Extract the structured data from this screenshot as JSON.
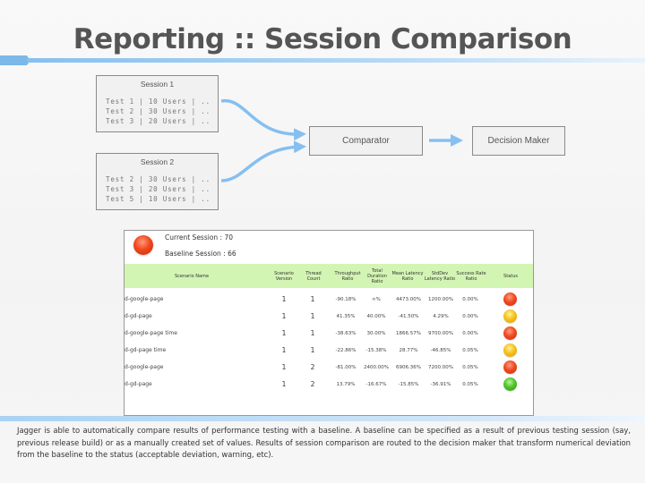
{
  "title": "Reporting :: Session Comparison",
  "diagram": {
    "session1": {
      "title": "Session 1",
      "lines": [
        "Test 1 | 10 Users | ..",
        "Test 2 | 30 Users | ..",
        "Test 3 | 20 Users | .."
      ]
    },
    "session2": {
      "title": "Session 2",
      "lines": [
        "Test 2 | 30 Users | ..",
        "Test 3 | 20 Users | ..",
        "Test 5 | 10 Users | .."
      ]
    },
    "comparator": "Comparator",
    "decision_maker": "Decision Maker",
    "arrow_color": "#86bff0"
  },
  "report": {
    "overall_status": "red",
    "current_session": "Current Session : 70",
    "baseline_session": "Baseline Session : 66",
    "header_bg": "#d3f5b4",
    "columns": [
      "Scenario Name",
      "Scenario Version",
      "Thread Count",
      "Throughput Ratio",
      "Total Duration Ratio",
      "Mean Latency Ratio",
      "StdDev Latency Ratio",
      "Success Rate Ratio",
      "Status"
    ],
    "rows": [
      {
        "name": "d-google-page",
        "version": "1",
        "threads": "1",
        "throughput": "-90.18%",
        "duration": "∞%",
        "mean": "4473.00%",
        "stddev": "1200.00%",
        "success": "0.00%",
        "status": "red"
      },
      {
        "name": "d-gd-page",
        "version": "1",
        "threads": "1",
        "throughput": "41.35%",
        "duration": "40.00%",
        "mean": "-41.50%",
        "stddev": "4.29%",
        "success": "0.00%",
        "status": "yellow"
      },
      {
        "name": "d-google-page time",
        "version": "1",
        "threads": "1",
        "throughput": "-38.63%",
        "duration": "30.00%",
        "mean": "1866.57%",
        "stddev": "9700.00%",
        "success": "0.00%",
        "status": "red"
      },
      {
        "name": "d-gd-page time",
        "version": "1",
        "threads": "1",
        "throughput": "-22.86%",
        "duration": "-15.38%",
        "mean": "28.77%",
        "stddev": "-46.85%",
        "success": "0.05%",
        "status": "yellow"
      },
      {
        "name": "d-google-page",
        "version": "1",
        "threads": "2",
        "throughput": "-81.00%",
        "duration": "2400.00%",
        "mean": "6906.36%",
        "stddev": "7200.00%",
        "success": "0.05%",
        "status": "red"
      },
      {
        "name": "d-gd-page",
        "version": "1",
        "threads": "2",
        "throughput": "13.79%",
        "duration": "-16.67%",
        "mean": "-15.85%",
        "stddev": "-36.91%",
        "success": "0.05%",
        "status": "green"
      }
    ]
  },
  "description": "Jagger is able to automatically compare results of performance testing with a baseline. A baseline can be specified as a result of previous testing session (say, previous release build) or as a manually created set of values. Results of session comparison are routed to the decision maker that transform numerical deviation from the baseline to the status (acceptable deviation, warning, etc)."
}
